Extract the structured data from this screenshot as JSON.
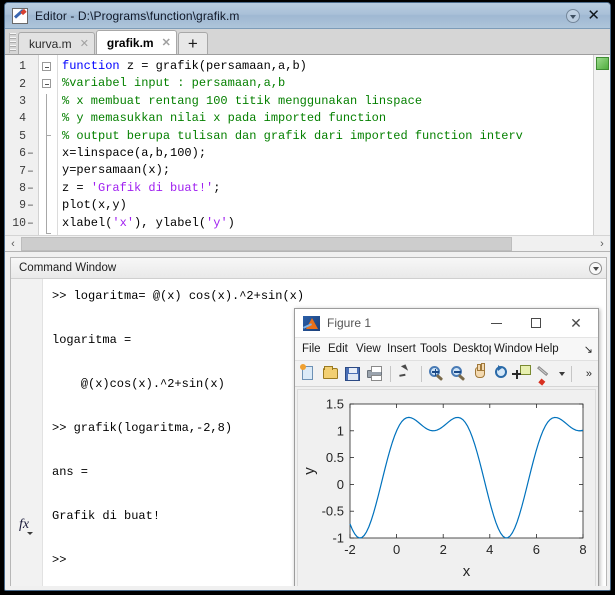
{
  "window": {
    "title": "Editor - D:\\Programs\\function\\grafik.m",
    "icon": "editor-pencil-icon",
    "dock_icon": "dock-arrow-icon",
    "close_label": "✕"
  },
  "tabs": {
    "items": [
      {
        "label": "kurva.m",
        "active": false,
        "close": "✕"
      },
      {
        "label": "grafik.m",
        "active": true,
        "close": "✕"
      }
    ],
    "add_label": "+"
  },
  "editor": {
    "analyzer_status": "ok",
    "scroll_left_arrow": "‹",
    "scroll_right_arrow": "›",
    "lines": [
      {
        "n": "1",
        "exec": "",
        "fold": "open",
        "tokens": [
          {
            "t": "function ",
            "c": "kw"
          },
          {
            "t": "z = grafik(persamaan,a,b)",
            "c": ""
          }
        ]
      },
      {
        "n": "2",
        "exec": "",
        "fold": "open",
        "tokens": [
          {
            "t": "%variabel input : persamaan,a,b",
            "c": "cmt"
          }
        ]
      },
      {
        "n": "3",
        "exec": "",
        "fold": "",
        "tokens": [
          {
            "t": "% x membuat rentang 100 titik menggunakan linspace",
            "c": "cmt"
          }
        ]
      },
      {
        "n": "4",
        "exec": "",
        "fold": "",
        "tokens": [
          {
            "t": "% y memasukkan nilai x pada imported function",
            "c": "cmt"
          }
        ]
      },
      {
        "n": "5",
        "exec": "",
        "fold": "tick",
        "tokens": [
          {
            "t": "% output berupa tulisan dan grafik dari imported function interv",
            "c": "cmt"
          }
        ]
      },
      {
        "n": "6",
        "exec": "–",
        "fold": "",
        "tokens": [
          {
            "t": "x=linspace(a,b,100);",
            "c": ""
          }
        ]
      },
      {
        "n": "7",
        "exec": "–",
        "fold": "",
        "tokens": [
          {
            "t": "y=persamaan(x);",
            "c": ""
          }
        ]
      },
      {
        "n": "8",
        "exec": "–",
        "fold": "",
        "tokens": [
          {
            "t": "z = ",
            "c": ""
          },
          {
            "t": "'Grafik di buat!'",
            "c": "str"
          },
          {
            "t": ";",
            "c": ""
          }
        ]
      },
      {
        "n": "9",
        "exec": "–",
        "fold": "",
        "tokens": [
          {
            "t": "plot(x,y)",
            "c": ""
          }
        ]
      },
      {
        "n": "10",
        "exec": "–",
        "fold": "end",
        "tokens": [
          {
            "t": "xlabel(",
            "c": ""
          },
          {
            "t": "'x'",
            "c": "str"
          },
          {
            "t": "), ylabel(",
            "c": ""
          },
          {
            "t": "'y'",
            "c": "str"
          },
          {
            "t": ")",
            "c": ""
          }
        ]
      }
    ]
  },
  "command_window": {
    "title": "Command Window",
    "collapse_icon": "chevron-down-icon",
    "fx_label": "fx",
    "lines": [
      ">> logaritma= @(x) cos(x).^2+sin(x)",
      "",
      "logaritma =",
      "",
      "    @(x)cos(x).^2+sin(x)",
      "",
      ">> grafik(logaritma,-2,8)",
      "",
      "ans =",
      "",
      "Grafik di buat!",
      "",
      ">>"
    ]
  },
  "figure": {
    "title": "Figure 1",
    "icon": "matlab-logo-icon",
    "minimize": "minimize-icon",
    "maximize": "maximize-icon",
    "close": "close-icon",
    "menus": [
      "File",
      "Edit",
      "View",
      "Insert",
      "Tools",
      "Desktop",
      "Window",
      "Help"
    ],
    "menu_overflow": "↘",
    "toolbar": [
      {
        "name": "new-figure-icon",
        "cls": "ic-new"
      },
      {
        "name": "open-file-icon",
        "cls": "ic-open"
      },
      {
        "name": "save-figure-icon",
        "cls": "ic-save"
      },
      {
        "name": "print-figure-icon",
        "cls": "ic-print"
      },
      {
        "name": "pointer-icon",
        "cls": "ic-pointer"
      },
      {
        "name": "zoom-in-icon",
        "cls": "ic-mag"
      },
      {
        "name": "zoom-out-icon",
        "cls": "ic-mag"
      },
      {
        "name": "pan-hand-icon",
        "cls": "ic-hand"
      },
      {
        "name": "rotate-3d-icon",
        "cls": "ic-rot"
      },
      {
        "name": "data-cursor-icon",
        "cls": "ic-dc"
      },
      {
        "name": "brush-icon",
        "cls": "ic-brush"
      }
    ],
    "toolbar_overflow": "»"
  },
  "chart_data": {
    "type": "line",
    "title": "",
    "expression": "cos(x).^2+sin(x)",
    "xlabel": "x",
    "ylabel": "y",
    "xlim": [
      -2,
      8
    ],
    "ylim": [
      -1,
      1.5
    ],
    "xticks": [
      -2,
      0,
      2,
      4,
      6,
      8
    ],
    "xticklabels": [
      "-2",
      "0",
      "2",
      "4",
      "6",
      "8"
    ],
    "yticks": [
      -1,
      -0.5,
      0,
      0.5,
      1,
      1.5
    ],
    "yticklabels": [
      "-1",
      "-0.5",
      "0",
      "0.5",
      "1",
      "1.5"
    ],
    "grid": false,
    "legend": null,
    "line_color": "#0072bd",
    "line_width": 1.2,
    "npoints": 100,
    "series": [
      {
        "name": "cos(x).^2+sin(x)",
        "x": [
          -2,
          -1.8,
          -1.6,
          -1.4,
          -1.2,
          -1,
          -0.8,
          -0.6,
          -0.4,
          -0.2,
          0,
          0.2,
          0.4,
          0.6,
          0.8,
          1,
          1.2,
          1.4,
          1.6,
          1.8,
          2,
          2.2,
          2.4,
          2.6,
          2.8,
          3,
          3.2,
          3.4,
          3.6,
          3.8,
          4,
          4.2,
          4.4,
          4.6,
          4.8,
          5,
          5.2,
          5.4,
          5.6,
          5.8,
          6,
          6.2,
          6.4,
          6.6,
          6.8,
          7,
          7.2,
          7.4,
          7.6,
          7.8,
          8
        ],
        "y": [
          -0.736,
          -0.922,
          -1.0,
          -0.957,
          -0.801,
          -0.55,
          -0.232,
          0.116,
          0.459,
          0.762,
          1.0,
          1.158,
          1.238,
          1.25,
          1.217,
          1.133,
          1.064,
          1.014,
          1.0,
          1.025,
          1.082,
          1.156,
          1.227,
          1.25,
          1.198,
          1.121,
          0.921,
          0.662,
          0.337,
          -0.004,
          -0.329,
          -0.61,
          -0.818,
          -0.94,
          -0.982,
          -0.948,
          -0.829,
          -0.625,
          -0.336,
          -0.004,
          0.327,
          0.641,
          0.91,
          1.115,
          1.235,
          1.25,
          1.207,
          1.128,
          1.053,
          1.006,
          1.003
        ]
      }
    ]
  }
}
